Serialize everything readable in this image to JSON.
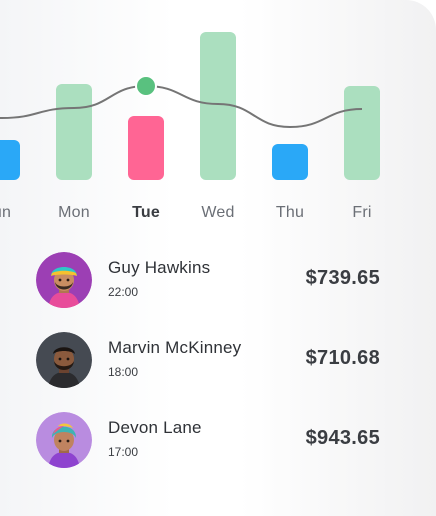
{
  "chart_data": {
    "type": "bar",
    "categories": [
      "Sun",
      "Mon",
      "Tue",
      "Wed",
      "Thu",
      "Fri"
    ],
    "visible_category_labels": [
      "un",
      "Mon",
      "Tue",
      "Wed",
      "Thu",
      "Fri"
    ],
    "values": [
      40,
      96,
      64,
      148,
      36,
      94
    ],
    "selected_category": "Tue",
    "bar_colors": [
      "#2aa8f7",
      "#abdfbf",
      "#ff6594",
      "#abdfbf",
      "#2aa8f7",
      "#abdfbf"
    ],
    "trend_line": [
      62,
      72,
      94,
      76,
      53,
      71
    ],
    "trend_marker_index": 2,
    "trend_marker_color": "#59c17f",
    "trend_line_color": "#757575",
    "grid": false,
    "legend": "none"
  },
  "transactions": [
    {
      "name": "Guy Hawkins",
      "time": "22:00",
      "amount": "$739.65",
      "avatar": "avatar-turban"
    },
    {
      "name": "Marvin McKinney",
      "time": "18:00",
      "amount": "$710.68",
      "avatar": "avatar-beard"
    },
    {
      "name": "Devon Lane",
      "time": "17:00",
      "amount": "$943.65",
      "avatar": "avatar-colorful-hair"
    }
  ]
}
